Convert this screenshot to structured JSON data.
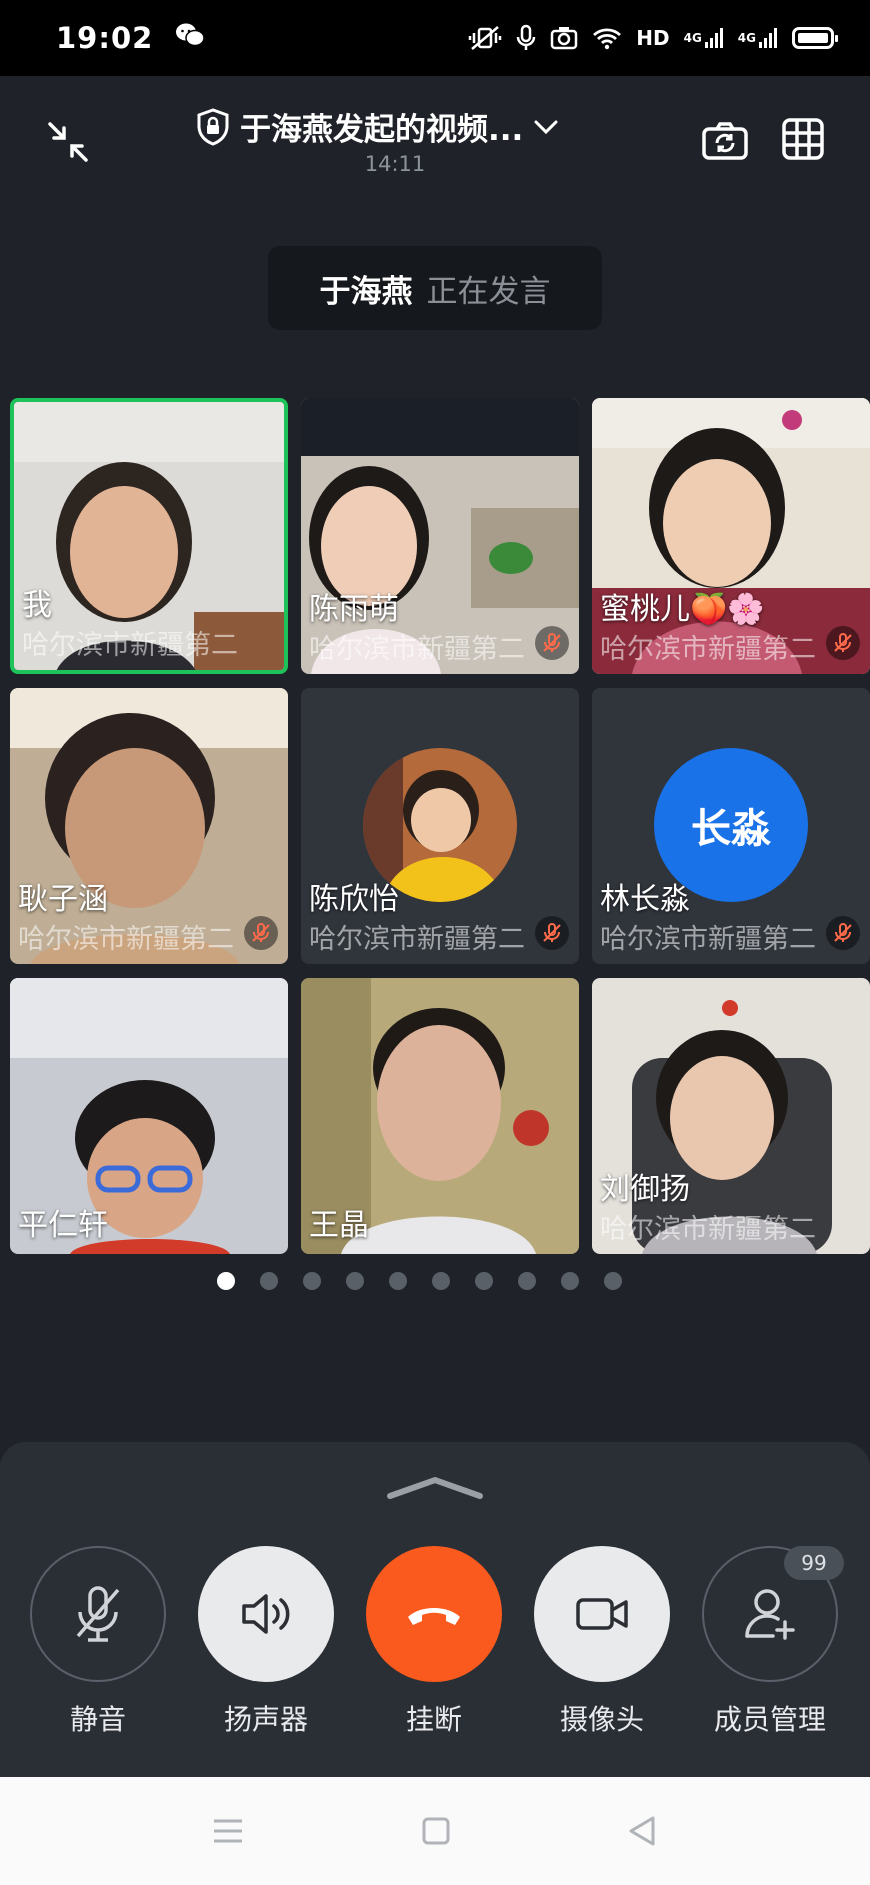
{
  "status_bar": {
    "time": "19:02",
    "network_label": "HD",
    "sim1": "4G",
    "sim2": "4G"
  },
  "header": {
    "title": "于海燕发起的视频...",
    "duration": "14:11"
  },
  "speaking_banner": {
    "name": "于海燕",
    "status": "正在发言"
  },
  "participants": [
    {
      "name": "我",
      "org": "哈尔滨市新疆第二",
      "muted": false,
      "active": true
    },
    {
      "name": "陈雨萌",
      "org": "哈尔滨市新疆第二",
      "muted": true,
      "active": false
    },
    {
      "name": "蜜桃儿🍑🌸",
      "org": "哈尔滨市新疆第二",
      "muted": true,
      "active": false
    },
    {
      "name": "耿子涵",
      "org": "哈尔滨市新疆第二",
      "muted": true,
      "active": false
    },
    {
      "name": "陈欣怡",
      "org": "哈尔滨市新疆第二",
      "muted": true,
      "active": false
    },
    {
      "name": "林长淼",
      "org": "哈尔滨市新疆第二",
      "muted": true,
      "active": false,
      "avatar_text": "长淼"
    },
    {
      "name": "平仁轩",
      "org": "",
      "muted": false,
      "active": false
    },
    {
      "name": "王晶",
      "org": "",
      "muted": false,
      "active": false
    },
    {
      "name": "刘御扬",
      "org": "哈尔滨市新疆第二",
      "muted": false,
      "active": false
    }
  ],
  "pager": {
    "current": 1,
    "total": 10
  },
  "controls": {
    "mute_label": "静音",
    "speaker_label": "扬声器",
    "hangup_label": "挂断",
    "camera_label": "摄像头",
    "members_label": "成员管理",
    "members_badge": "99"
  },
  "colors": {
    "active_border": "#1dc25a",
    "hangup": "#fa5a1e",
    "avatar_blue": "#1a72e8"
  }
}
